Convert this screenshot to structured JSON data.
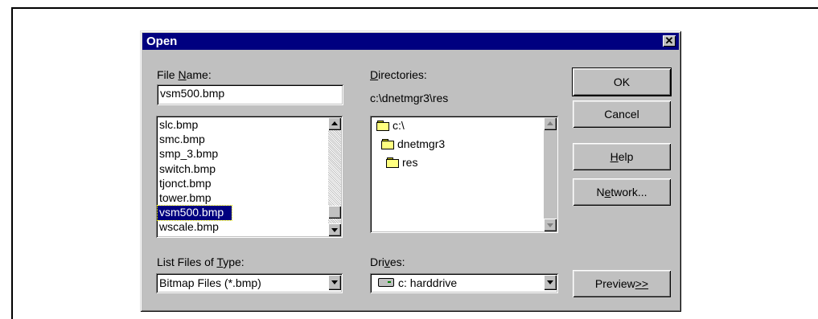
{
  "dialog": {
    "title": "Open",
    "close_glyph": "✕"
  },
  "file_name": {
    "label_pre": "File ",
    "label_accel": "N",
    "label_post": "ame:",
    "value": "vsm500.bmp"
  },
  "files": [
    {
      "name": "slc.bmp",
      "selected": false
    },
    {
      "name": "smc.bmp",
      "selected": false
    },
    {
      "name": "smp_3.bmp",
      "selected": false
    },
    {
      "name": "switch.bmp",
      "selected": false
    },
    {
      "name": "tjonct.bmp",
      "selected": false
    },
    {
      "name": "tower.bmp",
      "selected": false
    },
    {
      "name": "vsm500.bmp",
      "selected": true
    },
    {
      "name": "wscale.bmp",
      "selected": false
    }
  ],
  "directories": {
    "label_accel": "D",
    "label_post": "irectories:",
    "current_path": "c:\\dnetmgr3\\res",
    "items": [
      {
        "name": "c:\\",
        "icon": "open-folder-icon"
      },
      {
        "name": "dnetmgr3",
        "icon": "open-folder-icon"
      },
      {
        "name": "res",
        "icon": "open-folder-icon"
      }
    ]
  },
  "file_type": {
    "label_pre": "List Files of ",
    "label_accel": "T",
    "label_post": "ype:",
    "value": "Bitmap Files (*.bmp)"
  },
  "drives": {
    "label_pre": "Dri",
    "label_accel": "v",
    "label_post": "es:",
    "value": "c: harddrive",
    "icon": "hard-drive-icon"
  },
  "buttons": {
    "ok": "OK",
    "cancel": "Cancel",
    "help_accel": "H",
    "help_post": "elp",
    "network_pre": "N",
    "network_accel": "e",
    "network_post": "twork...",
    "preview_pre": "Preview ",
    "preview_accel": ">>"
  }
}
